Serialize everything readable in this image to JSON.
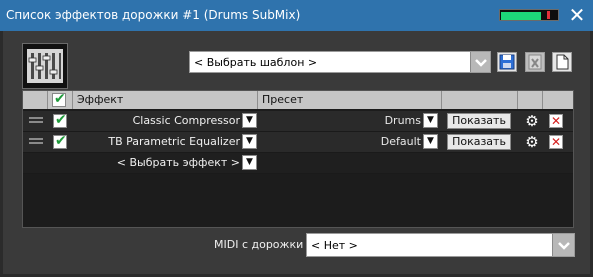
{
  "window": {
    "title": "Список эффектов дорожки #1 (Drums SubMix)",
    "title_bar_color": "#2f73ad",
    "meter_level": 0.7,
    "close_icon": "close-icon"
  },
  "toolbar": {
    "plugin_icon": "fx-chain-icon",
    "preset_placeholder": "< Выбрать шаблон >",
    "save_icon": "floppy-disk-icon",
    "delete_icon": "delete-preset-icon",
    "new_icon": "new-document-icon"
  },
  "table": {
    "columns": {
      "effect": "Эффект",
      "preset": "Пресет"
    },
    "rows": [
      {
        "enabled": true,
        "effect": "Classic Compressor",
        "preset": "Drums",
        "show_label": "Показать"
      },
      {
        "enabled": true,
        "effect": "TB Parametric Equalizer",
        "preset": "Default",
        "show_label": "Показать"
      }
    ],
    "add_effect_label": "< Выбрать эффект >"
  },
  "midi": {
    "label": "MIDI с дорожки :",
    "value": "< Нет >"
  }
}
